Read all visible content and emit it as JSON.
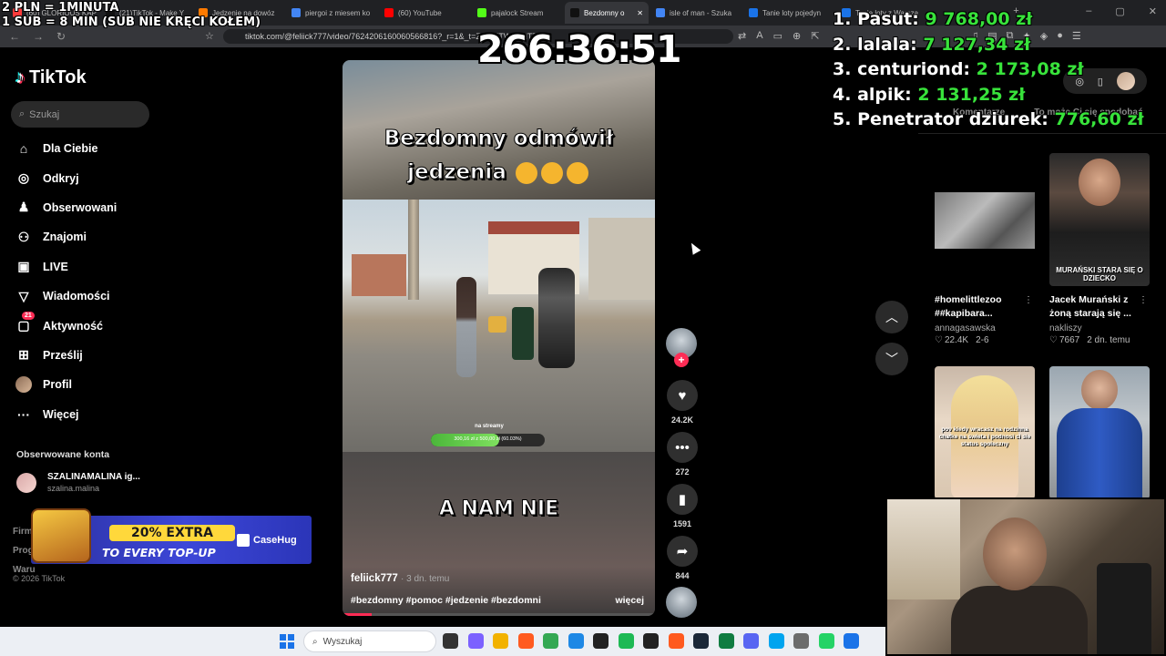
{
  "overlay": {
    "line1": "2 PLN =   1MINUTA",
    "line2": "1 SUB = 8 MIN (SUB NIE KRĘCI KOŁEM)",
    "timer": "266:36:51"
  },
  "leaderboard": [
    {
      "rank": "1.",
      "name": "Pasut:",
      "amount": "9 768,00 zł"
    },
    {
      "rank": "2.",
      "name": "lalala:",
      "amount": "7 127,34 zł"
    },
    {
      "rank": "3.",
      "name": "centuriond:",
      "amount": "2 173,08 zł"
    },
    {
      "rank": "4.",
      "name": "alpik:",
      "amount": "2 131,25 zł"
    },
    {
      "rank": "5.",
      "name": "Penetrator dziurek:",
      "amount": "776,60 zł"
    }
  ],
  "browser": {
    "tabs": [
      {
        "label": "(60) GLORIOUS KAP",
        "color": "#ff3b3b"
      },
      {
        "label": "(21)TikTok - Make Y",
        "color": "#111111"
      },
      {
        "label": "Jedzenie na dowóz",
        "color": "#ff7a00"
      },
      {
        "label": "piergoi z miesem ko",
        "color": "#4285f4"
      },
      {
        "label": "(60) YouTube",
        "color": "#ff0000"
      },
      {
        "label": "pajalock Stream",
        "color": "#53fc18"
      },
      {
        "label": "Bezdomny o",
        "color": "#111111",
        "active": true
      },
      {
        "label": "isle of man - Szuka",
        "color": "#4285f4"
      },
      {
        "label": "Tanie loty pojedyn",
        "color": "#1a73e8"
      },
      {
        "label": "Tanie loty z Warsza",
        "color": "#1a73e8"
      }
    ],
    "url": "tiktok.com/@feliick777/video/7624206160060566816?_r=1&_t=ZN-95TWRxNT79a"
  },
  "sidebar": {
    "logo": "TikTok",
    "search_placeholder": "Szukaj",
    "items": [
      {
        "label": "Dla Ciebie",
        "icon": "home-icon",
        "glyph": "⌂"
      },
      {
        "label": "Odkryj",
        "icon": "compass-icon",
        "glyph": "◎"
      },
      {
        "label": "Obserwowani",
        "icon": "following-icon",
        "glyph": "♟"
      },
      {
        "label": "Znajomi",
        "icon": "friends-icon",
        "glyph": "⚇"
      },
      {
        "label": "LIVE",
        "icon": "live-icon",
        "glyph": "▣"
      },
      {
        "label": "Wiadomości",
        "icon": "messages-icon",
        "glyph": "▽"
      },
      {
        "label": "Aktywność",
        "icon": "activity-icon",
        "glyph": "▢",
        "badge": "21"
      },
      {
        "label": "Prześlij",
        "icon": "upload-icon",
        "glyph": "⊞"
      },
      {
        "label": "Profil",
        "icon": "profile-icon",
        "glyph": ""
      },
      {
        "label": "Więcej",
        "icon": "more-icon",
        "glyph": "···"
      }
    ],
    "followed_title": "Obserwowane konta",
    "followed": {
      "name": "SZALINAMALINA ig...",
      "handle": "szalina.malina"
    },
    "footer_links": [
      "Firm",
      "Prog",
      "Waru"
    ],
    "copyright": "© 2026 TikTok"
  },
  "ad": {
    "pill": "20% EXTRA",
    "subtitle": "TO EVERY TOP-UP",
    "brand": "CaseHug"
  },
  "video": {
    "title_line1": "Bezdomny odmówił",
    "title_line2": "jedzenia",
    "progress_label": "na streamy",
    "progress_text": "300,16 zł z 500,00 zł (60.03%)",
    "progress_fraction": 0.6003,
    "caption": "A NAM NIE",
    "author": "feliick777",
    "posted": "· 3 dn. temu",
    "tags": "#bezdomny #pomoc #jedzenie #bezdomni",
    "more": "więcej"
  },
  "actions": {
    "likes": "24.2K",
    "comments": "272",
    "saves": "1591",
    "shares": "844"
  },
  "right_panel": {
    "tabs": [
      "Komentarze",
      "To może Ci się spodobać"
    ],
    "videos": [
      {
        "title": "#homelittlezoo ##kapibara...",
        "user": "annagasawska",
        "likes": "22.4K",
        "age": "2-6",
        "thumb_text": ""
      },
      {
        "title": "Jacek Murański z żoną starają się ...",
        "user": "nakliszy",
        "likes": "7667",
        "age": "2 dn. temu",
        "thumb_text": "MURAŃSKI STARA SIĘ O DZIECKO"
      },
      {
        "title": "",
        "user": "",
        "likes": "",
        "age": "",
        "thumb_text": "pov kiedy wracasz na rodzinna chatke na swieta i podnosi ci sie status spoleczny"
      },
      {
        "title": "",
        "user": "",
        "likes": "",
        "age": "",
        "thumb_text": ""
      }
    ]
  },
  "taskbar": {
    "search_placeholder": "Wyszukaj",
    "apps": [
      "#333333",
      "#7b61ff",
      "#f2b200",
      "#ff5a1f",
      "#34a853",
      "#1e88e5",
      "#222222",
      "#1db954",
      "#222222",
      "#ff5a1f",
      "#1b2838",
      "#107c41",
      "#5865f2",
      "#00a4ef",
      "#6c6c6c",
      "#25d366",
      "#1a73e8"
    ]
  }
}
